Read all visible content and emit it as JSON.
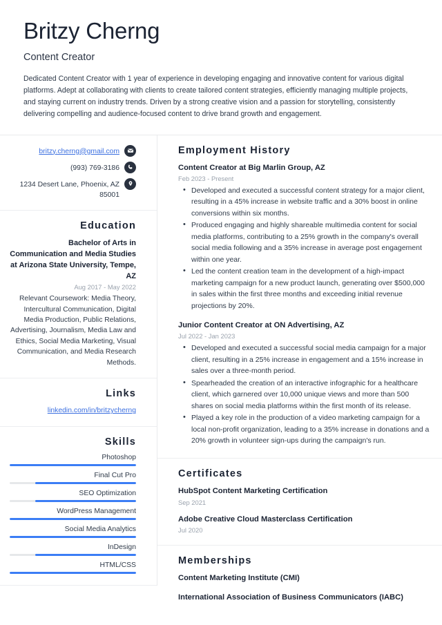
{
  "theme": {
    "accent_blue": "#3b7df5",
    "link_blue": "#3b6fe0",
    "text_dark": "#1b2333",
    "text_body": "#2f3a49",
    "text_muted": "#9aa2ad",
    "divider": "#eceef0",
    "icon_bg": "#29313f",
    "background": "#ffffff"
  },
  "header": {
    "full_name": "Britzy Cherng",
    "job_title": "Content Creator",
    "summary": "Dedicated Content Creator with 1 year of experience in developing engaging and innovative content for various digital platforms. Adept at collaborating with clients to create tailored content strategies, efficiently managing multiple projects, and staying current on industry trends. Driven by a strong creative vision and a passion for storytelling, consistently delivering compelling and audience-focused content to drive brand growth and engagement."
  },
  "contact": {
    "email": "britzy.cherng@gmail.com",
    "email_icon": "envelope-icon",
    "phone": "(993) 769-3186",
    "phone_icon": "phone-icon",
    "address": "1234 Desert Lane, Phoenix, AZ 85001",
    "address_icon": "location-pin-icon"
  },
  "education": {
    "heading": "Education",
    "degree": "Bachelor of Arts in Communication and Media Studies at Arizona State University, Tempe, AZ",
    "date": "Aug 2017 - May 2022",
    "description": "Relevant Coursework: Media Theory, Intercultural Communication, Digital Media Production, Public Relations, Advertising, Journalism, Media Law and Ethics, Social Media Marketing, Visual Communication, and Media Research Methods."
  },
  "links": {
    "heading": "Links",
    "items": [
      {
        "label": "linkedin.com/in/britzycherng"
      }
    ]
  },
  "skills": {
    "heading": "Skills",
    "items": [
      {
        "name": "Photoshop",
        "level": 100
      },
      {
        "name": "Final Cut Pro",
        "level": 80
      },
      {
        "name": "SEO Optimization",
        "level": 80
      },
      {
        "name": "WordPress Management",
        "level": 100
      },
      {
        "name": "Social Media Analytics",
        "level": 100
      },
      {
        "name": "InDesign",
        "level": 80
      },
      {
        "name": "HTML/CSS",
        "level": 100
      }
    ]
  },
  "employment": {
    "heading": "Employment History",
    "entries": [
      {
        "title": "Content Creator at Big Marlin Group, AZ",
        "date": "Feb 2023 - Present",
        "bullets": [
          "Developed and executed a successful content strategy for a major client, resulting in a 45% increase in website traffic and a 30% boost in online conversions within six months.",
          "Produced engaging and highly shareable multimedia content for social media platforms, contributing to a 25% growth in the company's overall social media following and a 35% increase in average post engagement within one year.",
          "Led the content creation team in the development of a high-impact marketing campaign for a new product launch, generating over $500,000 in sales within the first three months and exceeding initial revenue projections by 20%."
        ]
      },
      {
        "title": "Junior Content Creator at ON Advertising, AZ",
        "date": "Jul 2022 - Jan 2023",
        "bullets": [
          "Developed and executed a successful social media campaign for a major client, resulting in a 25% increase in engagement and a 15% increase in sales over a three-month period.",
          "Spearheaded the creation of an interactive infographic for a healthcare client, which garnered over 10,000 unique views and more than 500 shares on social media platforms within the first month of its release.",
          "Played a key role in the production of a video marketing campaign for a local non-profit organization, leading to a 35% increase in donations and a 20% growth in volunteer sign-ups during the campaign's run."
        ]
      }
    ]
  },
  "certificates": {
    "heading": "Certificates",
    "items": [
      {
        "name": "HubSpot Content Marketing Certification",
        "date": "Sep 2021"
      },
      {
        "name": "Adobe Creative Cloud Masterclass Certification",
        "date": "Jul 2020"
      }
    ]
  },
  "memberships": {
    "heading": "Memberships",
    "items": [
      {
        "name": "Content Marketing Institute (CMI)"
      },
      {
        "name": "International Association of Business Communicators (IABC)"
      }
    ]
  }
}
